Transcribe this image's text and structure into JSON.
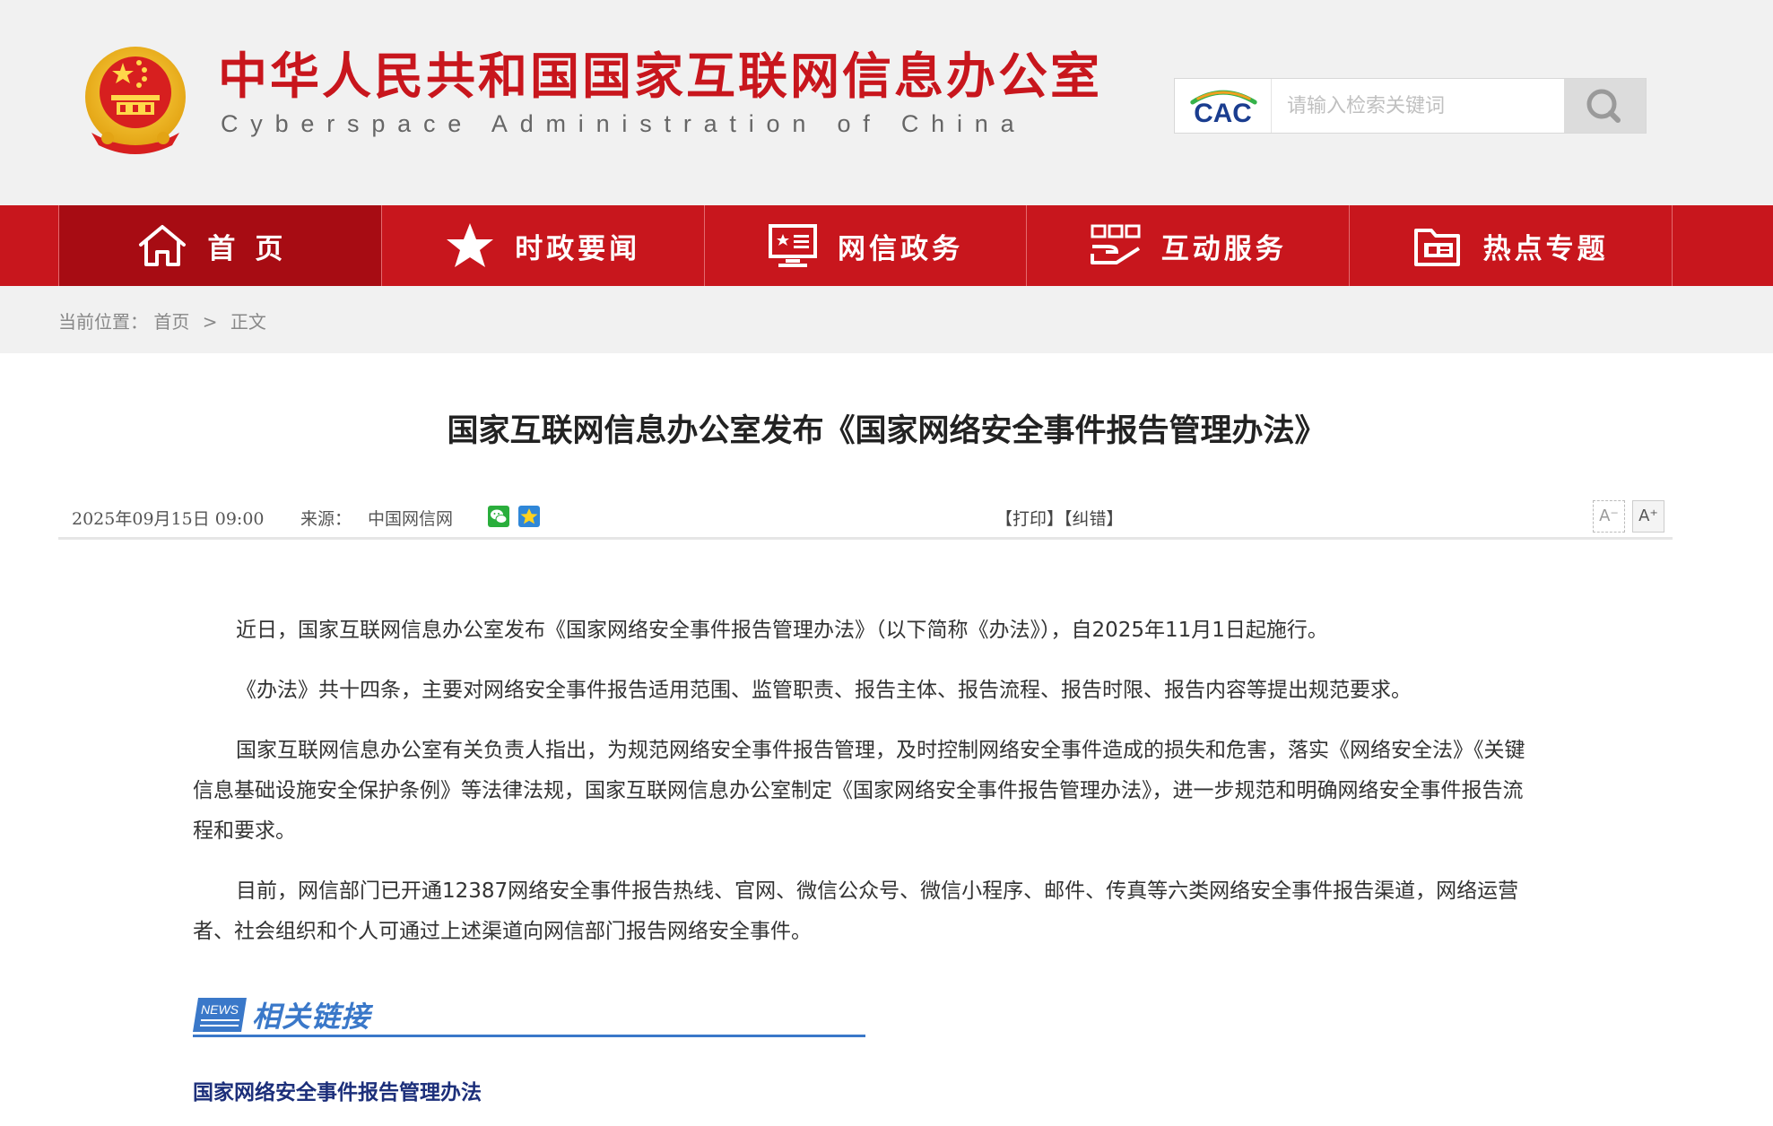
{
  "header": {
    "title": "中华人民共和国国家互联网信息办公室",
    "subtitle": "Cyberspace Administration of China",
    "search": {
      "logo_text": "CAC",
      "placeholder": "请输入检索关键词"
    }
  },
  "nav": {
    "items": [
      {
        "label": "首页",
        "icon": "home-icon"
      },
      {
        "label": "时政要闻",
        "icon": "star-icon"
      },
      {
        "label": "网信政务",
        "icon": "monitor-icon"
      },
      {
        "label": "互动服务",
        "icon": "service-icon"
      },
      {
        "label": "热点专题",
        "icon": "folder-icon"
      }
    ]
  },
  "breadcrumb": {
    "label": "当前位置：",
    "home": "首页",
    "separator": ">",
    "current": "正文"
  },
  "article": {
    "title": "国家互联网信息办公室发布《国家网络安全事件报告管理办法》",
    "date": "2025年09月15日  09:00",
    "source_label": "来源：",
    "source": "中国网信网",
    "print": "【打印】",
    "correct": "【纠错】",
    "font_decrease": "A⁻",
    "font_increase": "A⁺",
    "paragraphs": [
      "近日，国家互联网信息办公室发布《国家网络安全事件报告管理办法》（以下简称《办法》），自2025年11月1日起施行。",
      "《办法》共十四条，主要对网络安全事件报告适用范围、监管职责、报告主体、报告流程、报告时限、报告内容等提出规范要求。",
      "国家互联网信息办公室有关负责人指出，为规范网络安全事件报告管理，及时控制网络安全事件造成的损失和危害，落实《网络安全法》《关键信息基础设施安全保护条例》等法律法规，国家互联网信息办公室制定《国家网络安全事件报告管理办法》，进一步规范和明确网络安全事件报告流程和要求。",
      "目前，网信部门已开通12387网络安全事件报告热线、官网、微信公众号、微信小程序、邮件、传真等六类网络安全事件报告渠道，网络运营者、社会组织和个人可通过上述渠道向网信部门报告网络安全事件。"
    ]
  },
  "related": {
    "badge": "NEWS",
    "title": "相关链接",
    "links": [
      {
        "text": "国家网络安全事件报告管理办法"
      }
    ]
  },
  "colors": {
    "brand_red": "#c8161d",
    "nav_active": "#a70c13",
    "link_blue": "#3a78c9",
    "related_link": "#1c2f7a"
  }
}
